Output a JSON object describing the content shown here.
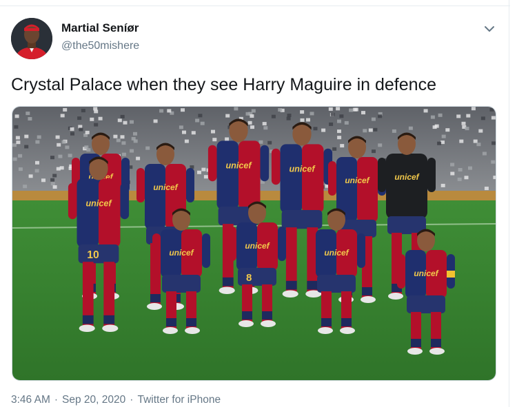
{
  "tweet": {
    "display_name": "Martial Seníør",
    "handle": "@the50mishere",
    "text": "Crystal Palace when they see Harry Maguire in defence",
    "menu_icon": "chevron-down-icon",
    "media": {
      "shirt_sponsor": "unicef",
      "back_numbers": [
        "10",
        "8"
      ]
    },
    "meta": {
      "time": "3:46 AM",
      "separator": "·",
      "date": "Sep 20, 2020",
      "source": "Twitter for iPhone"
    }
  },
  "colors": {
    "text_primary": "#14171a",
    "text_secondary": "#657786",
    "divider": "#e6ecf0",
    "shirt_blue": "#1f2f6e",
    "shirt_red": "#b3102a",
    "pitch_green": "#3e8a34",
    "avatar_shirt": "#d51e2b"
  }
}
